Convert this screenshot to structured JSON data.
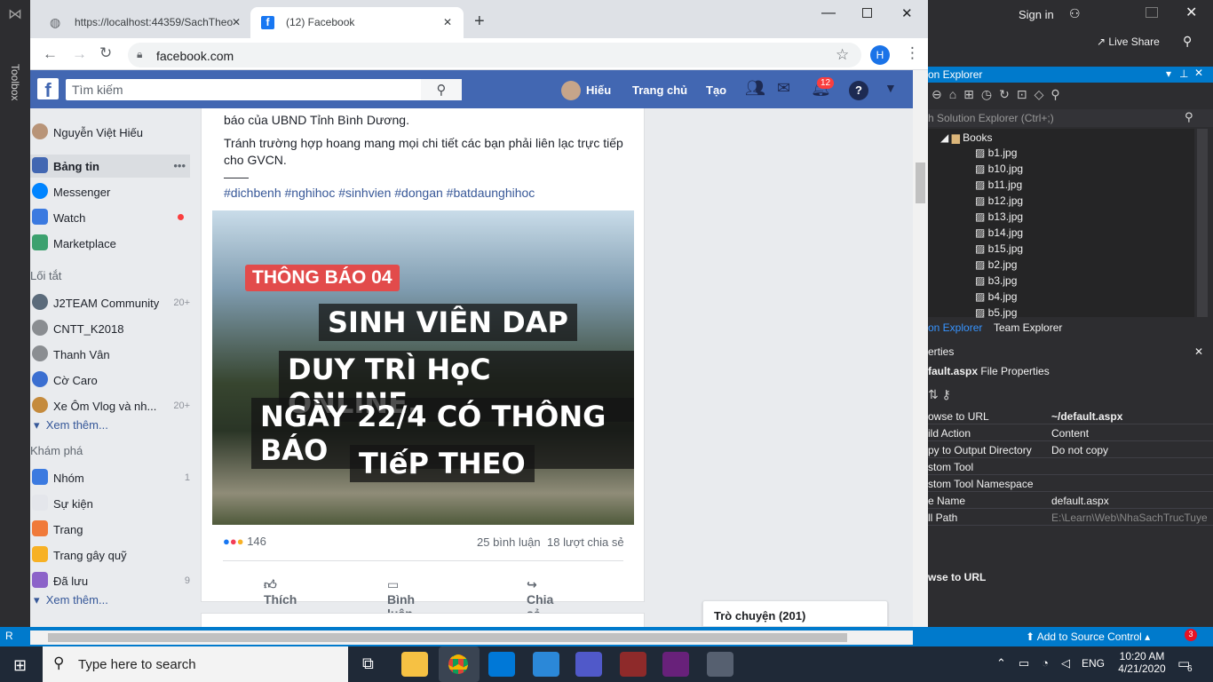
{
  "vs": {
    "toolbox_label": "Toolbox",
    "signin": "Sign in",
    "liveshare": "Live Share",
    "solution_explorer_title": "on Explorer",
    "search_placeholder": "h Solution Explorer (Ctrl+;)",
    "folder": "Books",
    "files": [
      "b1.jpg",
      "b10.jpg",
      "b11.jpg",
      "b12.jpg",
      "b13.jpg",
      "b14.jpg",
      "b15.jpg",
      "b2.jpg",
      "b3.jpg",
      "b4.jpg",
      "b5.jpg"
    ],
    "tabs": [
      "on Explorer",
      "Team Explorer"
    ],
    "properties_title": "erties",
    "props_file": "fault.aspx",
    "props_type": "File Properties",
    "props": [
      {
        "k": "owse to URL",
        "v": "~/default.aspx"
      },
      {
        "k": "ild Action",
        "v": "Content"
      },
      {
        "k": "py to Output Directory",
        "v": "Do not copy"
      },
      {
        "k": "stom Tool",
        "v": ""
      },
      {
        "k": "stom Tool Namespace",
        "v": ""
      },
      {
        "k": "e Name",
        "v": "default.aspx"
      },
      {
        "k": "ll Path",
        "v": "E:\\Learn\\Web\\NhaSachTrucTuye"
      }
    ],
    "prop_desc": "wse to URL",
    "add_source": "Add to Source Control",
    "status_badge": "3",
    "status_left": "R"
  },
  "chrome": {
    "tab1": "https://localhost:44359/SachTheo",
    "tab2": "(12) Facebook",
    "url": "facebook.com",
    "profile_initial": "H"
  },
  "fb": {
    "search_placeholder": "Tìm kiếm",
    "user_short": "Hiếu",
    "home": "Trang chủ",
    "create": "Tạo",
    "notif_count": "12",
    "user_full": "Nguyễn Việt Hiếu",
    "nav": [
      {
        "label": "Bảng tin",
        "more": "•••"
      },
      {
        "label": "Messenger"
      },
      {
        "label": "Watch"
      },
      {
        "label": "Marketplace"
      }
    ],
    "shortcuts_title": "Lối tắt",
    "shortcuts": [
      {
        "label": "J2TEAM Community",
        "count": "20+"
      },
      {
        "label": "CNTT_K2018",
        "count": ""
      },
      {
        "label": "Thanh Vân",
        "count": ""
      },
      {
        "label": "Cờ Caro",
        "count": ""
      },
      {
        "label": "Xe Ôm Vlog và nh...",
        "count": "20+"
      }
    ],
    "see_more": "Xem thêm...",
    "explore_title": "Khám phá",
    "explore": [
      {
        "label": "Nhóm",
        "count": "1"
      },
      {
        "label": "Sự kiện",
        "count": ""
      },
      {
        "label": "Trang",
        "count": ""
      },
      {
        "label": "Trang gây quỹ",
        "count": ""
      },
      {
        "label": "Đã lưu",
        "count": "9"
      }
    ],
    "post": {
      "text1": "báo của UBND Tỉnh Bình Dương.",
      "text2": "Tránh trường hợp hoang mang mọi chi tiết các bạn phải liên lạc trực tiếp cho GVCN.",
      "divider": "——",
      "hashtags": "#dichbenh #nghihoc #sinhvien #dongan #batdaunghihoc",
      "badge": "THÔNG BÁO 04",
      "lines": [
        "SINH VIÊN DAP",
        "DUY TRÌ HọC ONLINE.",
        "NGÀY 22/4 CÓ THÔNG BÁO",
        "TIếP THEO"
      ],
      "reactions": "146",
      "comments": "25 bình luận",
      "shares": "18 lượt chia sẻ",
      "like": "Thích",
      "comment": "Bình luận",
      "share": "Chia sẻ"
    },
    "chat": "Trò chuyện (201)"
  },
  "taskbar": {
    "search": "Type here to search",
    "lang": "ENG",
    "time": "10:20 AM",
    "date": "4/21/2020",
    "notif": "6"
  }
}
